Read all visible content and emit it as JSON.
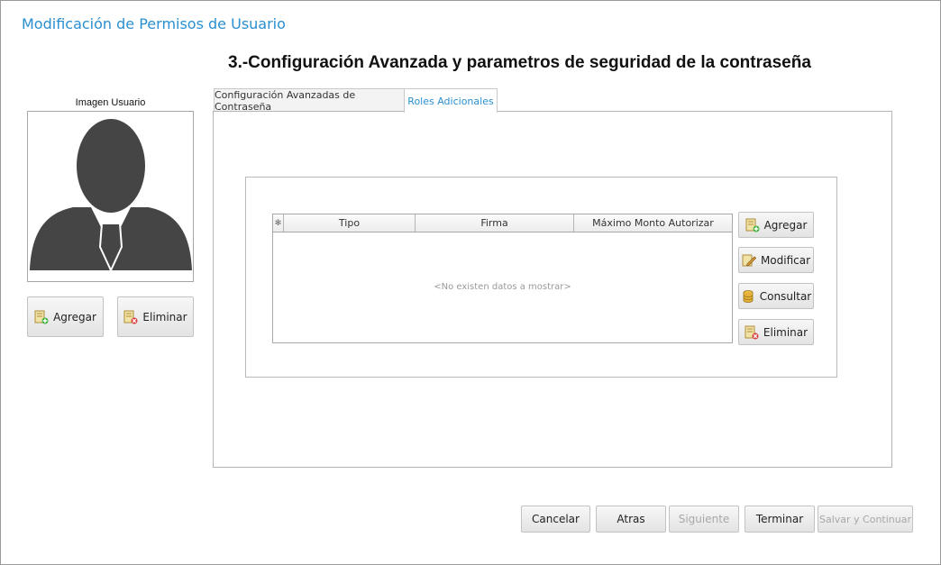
{
  "window": {
    "title": "Modificación de Permisos de Usuario"
  },
  "heading": "3.-Configuración Avanzada y parametros de seguridad de la contraseña",
  "user_image": {
    "caption": "Imagen Usuario",
    "add_label": "Agregar",
    "delete_label": "Eliminar"
  },
  "tabs": [
    {
      "label": "Configuración Avanzadas de Contraseña",
      "active": false
    },
    {
      "label": "Roles Adicionales",
      "active": true
    }
  ],
  "grid": {
    "new_row_glyph": "✻",
    "columns": [
      "Tipo",
      "Firma",
      "Máximo Monto Autorizar"
    ],
    "empty_text": "<No existen datos a mostrar>"
  },
  "grid_actions": {
    "add": "Agregar",
    "modify": "Modificar",
    "query": "Consultar",
    "delete": "Eliminar"
  },
  "footer": {
    "cancel": "Cancelar",
    "back": "Atras",
    "next": "Siguiente",
    "finish": "Terminar",
    "save_continue": "Salvar y Continuar"
  },
  "colors": {
    "accent": "#2a8fd0",
    "avatar_silhouette": "#454545",
    "disabled_text": "#a8a8a8"
  }
}
